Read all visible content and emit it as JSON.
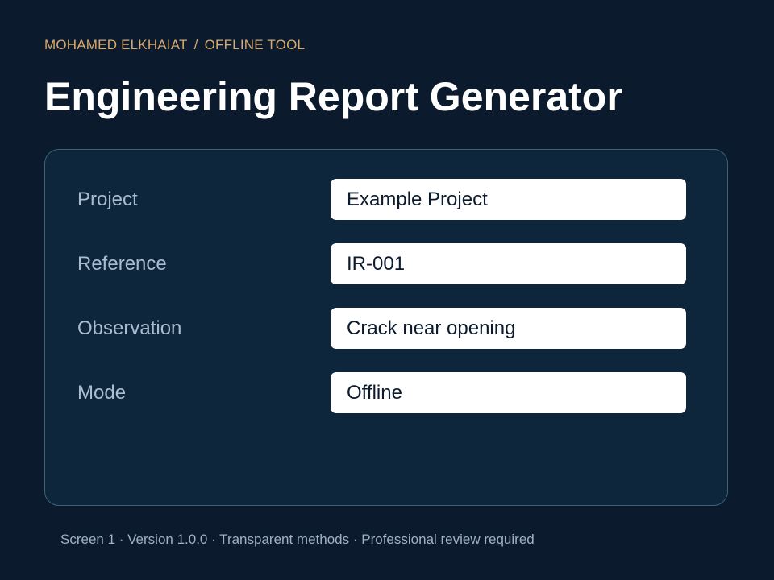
{
  "breadcrumb": {
    "author": "MOHAMED ELKHAIAT",
    "separator": "/",
    "section": "OFFLINE TOOL"
  },
  "page": {
    "title": "Engineering Report Generator"
  },
  "form": {
    "fields": [
      {
        "label": "Project",
        "value": "Example Project"
      },
      {
        "label": "Reference",
        "value": "IR-001"
      },
      {
        "label": "Observation",
        "value": "Crack near opening"
      },
      {
        "label": "Mode",
        "value": "Offline"
      }
    ]
  },
  "footer": {
    "text": "Screen 1 · Version 1.0.0 · Transparent methods · Professional review required"
  },
  "colors": {
    "background": "#0b1a2c",
    "card": "#0e263b",
    "card_border": "#3a6378",
    "accent": "#d9a86c",
    "label": "#a8bdd0"
  }
}
